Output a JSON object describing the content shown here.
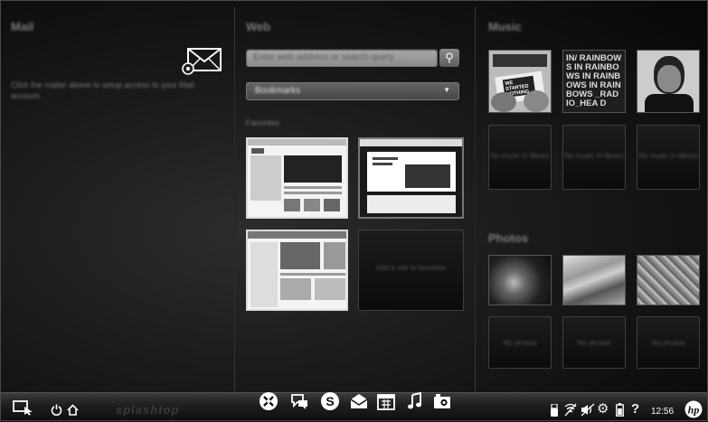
{
  "mail": {
    "title": "Mail",
    "hint": "Click the mailer above to setup access to your Mail account.",
    "icon": "mail-settings-icon"
  },
  "web": {
    "title": "Web",
    "search_placeholder": "Enter web address or search query",
    "bookmarks_label": "Bookmarks",
    "favorites_label": "Favorites",
    "empty_slot_label": "Add a site to favorites",
    "thumbnails": [
      "hp-product-page",
      "customize-and-save-page",
      "news-portal-page",
      "empty"
    ]
  },
  "music": {
    "title": "Music",
    "albums": [
      {
        "icon": "album-we-started-nothing",
        "text": "WE STARTED NOTHING"
      },
      {
        "icon": "album-in-rainbows",
        "text": "IN/ RAINBOWS IN RAINBOWS IN RAINBOWS IN RAINBOWS _RAD IO_HEA D"
      },
      {
        "icon": "album-portrait"
      }
    ],
    "empty_label": "No music in library"
  },
  "photos": {
    "title": "Photos",
    "items": [
      "photo-sea-creature",
      "photo-sand-dunes",
      "photo-foliage"
    ],
    "empty_label": "No photos"
  },
  "taskbar": {
    "brand": "splashtop",
    "clock": "12:56",
    "left_icons": [
      "switch-window-icon",
      "power-icon",
      "home-icon"
    ],
    "dock_icons": [
      "photo-editor-icon",
      "chat-icon",
      "skype-icon",
      "mail-icon",
      "calendar-icon",
      "music-note-icon",
      "camera-icon"
    ],
    "tray_icons": [
      "usb-icon",
      "wifi-off-icon",
      "volume-mute-icon",
      "settings-gear-icon",
      "battery-icon",
      "help-icon",
      "hp-logo-icon"
    ]
  }
}
